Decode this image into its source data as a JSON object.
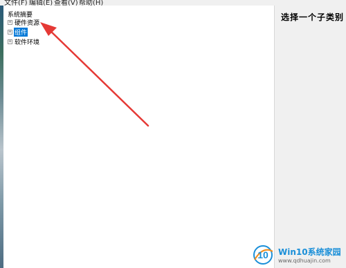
{
  "menubar": {
    "items": [
      {
        "label": "文件(F)"
      },
      {
        "label": "编辑(E)"
      },
      {
        "label": "查看(V)"
      },
      {
        "label": "帮助(H)"
      }
    ]
  },
  "tree": {
    "root_label": "系统摘要",
    "items": [
      {
        "label": "硬件资源",
        "expander": "+",
        "selected": false
      },
      {
        "label": "组件",
        "expander": "+",
        "selected": true
      },
      {
        "label": "软件环境",
        "expander": "+",
        "selected": false
      }
    ]
  },
  "detail": {
    "title": "选择一个子类别"
  },
  "colors": {
    "selection": "#0078d7",
    "arrow": "#e53935",
    "watermark_blue": "#1a8fd8",
    "watermark_orange": "#f28c1a"
  },
  "watermark": {
    "logo_text": "10",
    "title": "Win10系统家园",
    "url": "www.qdhuajin.com"
  }
}
